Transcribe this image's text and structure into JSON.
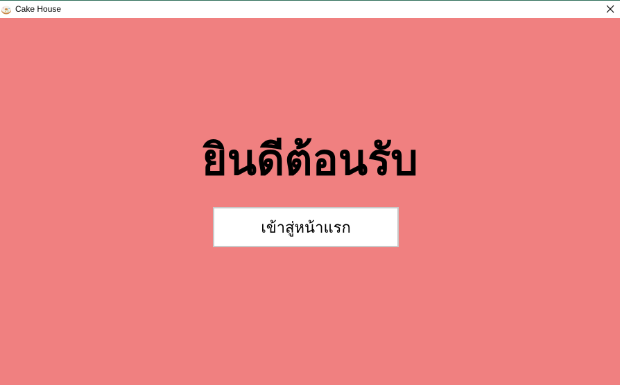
{
  "window": {
    "title": "Cake House",
    "app_icon": "donut-icon",
    "close_icon": "close-icon"
  },
  "main": {
    "heading": "ยินดีต้อนรับ",
    "enter_button_label": "เข้าสู่หน้าแรก"
  },
  "colors": {
    "background": "#f08080",
    "button_background": "#ffffff",
    "button_border": "#c9c9c9",
    "text": "#000000"
  }
}
